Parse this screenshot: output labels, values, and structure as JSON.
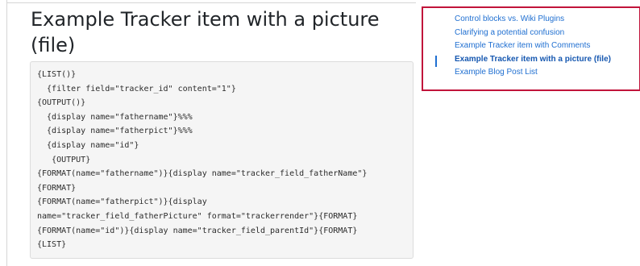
{
  "article": {
    "title": "Example Tracker item with a picture (file)",
    "code_lines": [
      "{LIST()}",
      "  {filter field=\"tracker_id\" content=\"1\"}",
      "{OUTPUT()}",
      "  {display name=\"fathername\"}%%%",
      "  {display name=\"fatherpict\"}%%%",
      "  {display name=\"id\"}",
      "   {OUTPUT}",
      "{FORMAT(name=\"fathername\")}{display name=\"tracker_field_fatherName\"}",
      "{FORMAT}",
      "{FORMAT(name=\"fatherpict\")}{display",
      "name=\"tracker_field_fatherPicture\" format=\"trackerrender\"}{FORMAT}",
      "{FORMAT(name=\"id\")}{display name=\"tracker_field_parentId\"}{FORMAT}",
      "{LIST}"
    ]
  },
  "toc": {
    "items": [
      {
        "label": "Control blocks vs. Wiki Plugins",
        "active": false
      },
      {
        "label": "Clarifying a potential confusion",
        "active": false
      },
      {
        "label": "Example Tracker item with Comments",
        "active": false
      },
      {
        "label": "Example Tracker item with a picture (file)",
        "active": true
      },
      {
        "label": "Example Blog Post List",
        "active": false
      }
    ],
    "colors": {
      "border": "#c1143b",
      "link": "#1f6fd1",
      "active_link": "#1557b0"
    }
  }
}
